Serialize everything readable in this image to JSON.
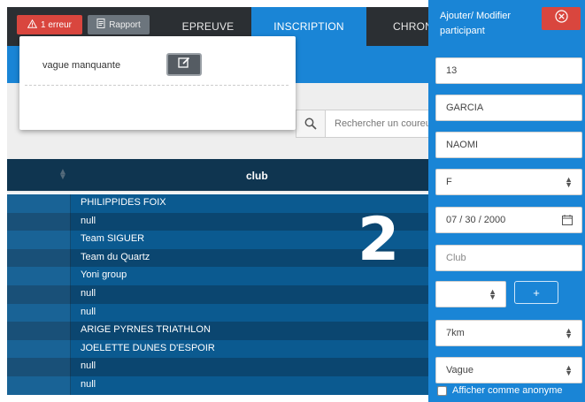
{
  "topbar": {
    "error_button": "1 erreur",
    "report_button": "Rapport",
    "tabs": [
      {
        "label": "EPREUVE"
      },
      {
        "label": "INSCRIPTION"
      },
      {
        "label": "CHRONO"
      }
    ]
  },
  "popup": {
    "label": "vague manquante"
  },
  "search": {
    "placeholder": "Rechercher un coureur"
  },
  "table": {
    "column_club": "club",
    "rows": [
      "PHILIPPIDES FOIX",
      "null",
      "Team SIGUER",
      "Team du Quartz",
      "Yoni group",
      "null",
      "null",
      "ARIGE PYRNES TRIATHLON",
      "JOELETTE DUNES D'ESPOIR",
      "null",
      "null"
    ]
  },
  "overlay_number": "2",
  "panel": {
    "title": "Ajouter/ Modifier participant",
    "fields": {
      "dossard": "13",
      "nom": "GARCIA",
      "prenom": "NAOMI",
      "sexe": "F",
      "date_naissance": "07 / 30 / 2000",
      "club_placeholder": "Club",
      "add_button": "+",
      "epreuve": "7km",
      "vague": "Vague"
    },
    "anonymous_label": "Afficher comme anonyme"
  },
  "colors": {
    "primary": "#1a85d6",
    "danger": "#d9463e",
    "dark_nav": "#2b2f33",
    "table_row_a": "#0b5a90",
    "table_row_b": "#0b4670"
  }
}
